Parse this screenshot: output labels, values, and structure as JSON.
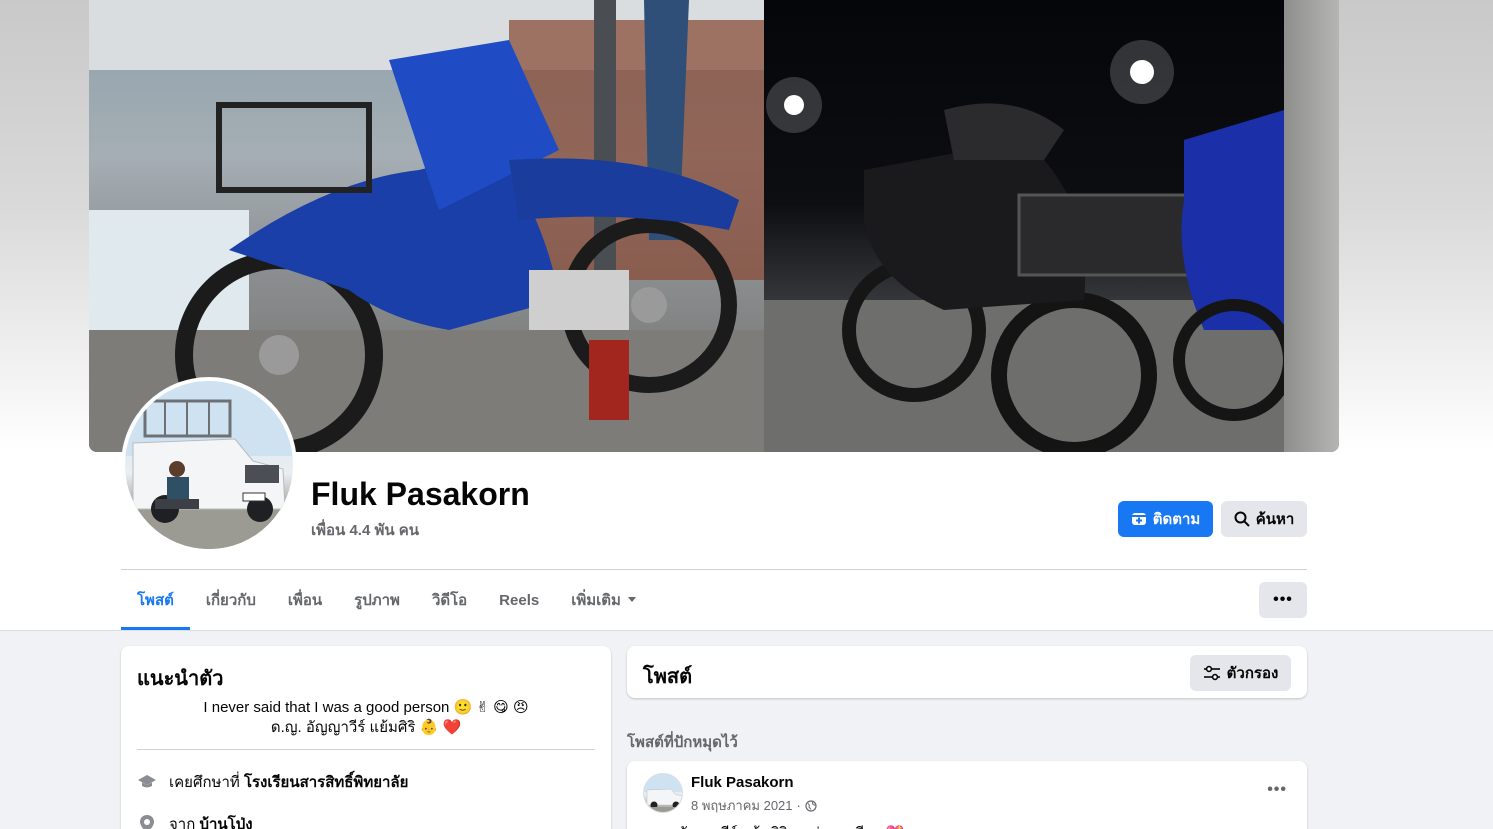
{
  "profile": {
    "name": "Fluk Pasakorn",
    "friends": "เพื่อน 4.4 พัน คน"
  },
  "actions": {
    "follow_label": "ติดตาม",
    "search_label": "ค้นหา",
    "more_label": "•••"
  },
  "tabs": [
    {
      "label": "โพสต์",
      "active": true
    },
    {
      "label": "เกี่ยวกับ",
      "active": false
    },
    {
      "label": "เพื่อน",
      "active": false
    },
    {
      "label": "รูปภาพ",
      "active": false
    },
    {
      "label": "วิดีโอ",
      "active": false
    },
    {
      "label": "Reels",
      "active": false
    },
    {
      "label": "เพิ่มเติม",
      "active": false
    }
  ],
  "intro": {
    "title": "แนะนำตัว",
    "bio_line1": "I never said that I was a good person 🙂 ✌ 😋 😠",
    "bio_line2": "ด.ญ. อัญญาวีร์ แย้มศิริ 👶 ❤️",
    "studied_prefix": "เคยศึกษาที่",
    "studied_value": "โรงเรียนสารสิทธิ์พิทยาลัย",
    "from_prefix": "จาก",
    "from_value": "บ้านโป่ง"
  },
  "posts_section": {
    "title": "โพสต์",
    "filter_label": "ตัวกรอง",
    "pinned_label": "โพสต์ที่ปักหมุดไว้"
  },
  "post": {
    "author": "Fluk Pasakorn",
    "date": "8 พฤษภาคม 2021",
    "separator": "·",
    "text_fragment": "ด.ญ. อัญญาวีร์ แย้มศิริ ลูกพ่อคนเดียว 💖"
  },
  "colors": {
    "accent": "#1877f2",
    "background": "#f0f2f5",
    "secondary_text": "#65676b"
  }
}
